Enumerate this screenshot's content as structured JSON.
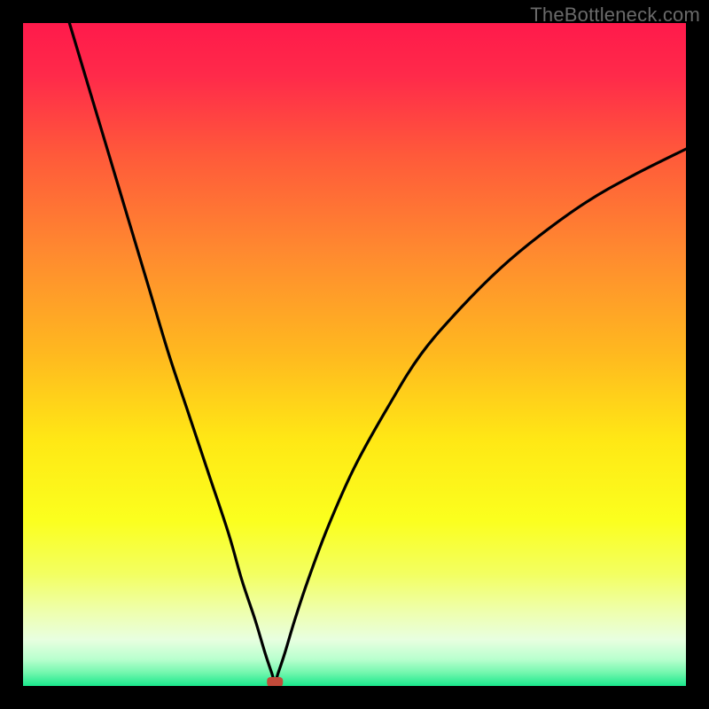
{
  "watermark": "TheBottleneck.com",
  "chart_data": {
    "type": "line",
    "title": "",
    "xlabel": "",
    "ylabel": "",
    "xlim": [
      0,
      100
    ],
    "ylim": [
      0,
      100
    ],
    "legend": false,
    "grid": false,
    "background": "rainbow-gradient",
    "annotations": [
      {
        "type": "marker",
        "shape": "rounded-rect",
        "color": "#c24a3a",
        "x": 38,
        "y": 0.6
      }
    ],
    "series": [
      {
        "name": "bottleneck-curve",
        "color": "#000000",
        "x": [
          7,
          10,
          13,
          16,
          19,
          22,
          25,
          28,
          31,
          33,
          35,
          36.5,
          37.5,
          38,
          38.5,
          39.5,
          41,
          43,
          46,
          50,
          55,
          60,
          66,
          72,
          78,
          85,
          92,
          100
        ],
        "values": [
          100,
          90,
          80,
          70,
          60,
          50,
          41,
          32,
          23,
          16,
          10,
          5,
          2,
          0.6,
          2,
          5,
          10,
          16,
          24,
          33,
          42,
          50,
          57,
          63,
          68,
          73,
          77,
          81
        ]
      }
    ]
  }
}
